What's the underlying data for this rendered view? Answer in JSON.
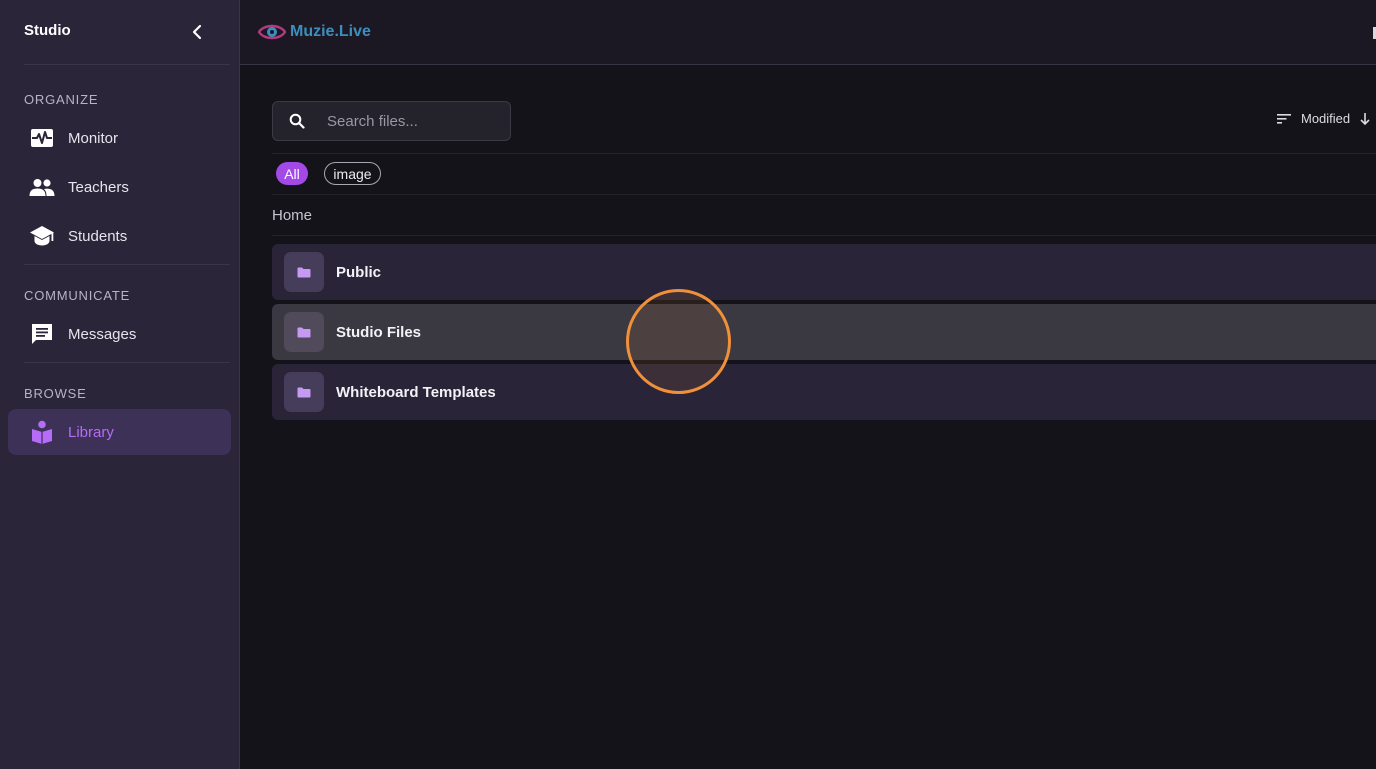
{
  "sidebar": {
    "title": "Studio",
    "sections": [
      {
        "label": "ORGANIZE",
        "items": [
          {
            "label": "Monitor",
            "icon": "monitor-heart-icon"
          },
          {
            "label": "Teachers",
            "icon": "people-icon"
          },
          {
            "label": "Students",
            "icon": "school-icon"
          }
        ]
      },
      {
        "label": "COMMUNICATE",
        "items": [
          {
            "label": "Messages",
            "icon": "chat-icon"
          }
        ]
      },
      {
        "label": "BROWSE",
        "items": [
          {
            "label": "Library",
            "icon": "library-icon",
            "active": true
          }
        ]
      }
    ]
  },
  "header": {
    "logo_text": "Muzie.Live",
    "logo_icon": "eye-logo-icon"
  },
  "search": {
    "placeholder": "Search files...",
    "value": ""
  },
  "sort": {
    "label": "Modified",
    "icon": "sort-icon",
    "direction_icon": "arrow-down-icon"
  },
  "filters": [
    {
      "label": "All",
      "selected": true
    },
    {
      "label": "image",
      "selected": false
    }
  ],
  "breadcrumb": "Home",
  "folders": [
    {
      "name": "Public",
      "icon": "folder-icon"
    },
    {
      "name": "Studio Files",
      "icon": "folder-icon",
      "hovered": true
    },
    {
      "name": "Whiteboard Templates",
      "icon": "folder-icon"
    }
  ],
  "colors": {
    "accent": "#a249e8",
    "active_label": "#b66cf6",
    "sidebar_bg": "#2a2538",
    "main_bg": "#141319",
    "folder_bg": "#2a2438",
    "click_indicator": "#f0913a"
  }
}
